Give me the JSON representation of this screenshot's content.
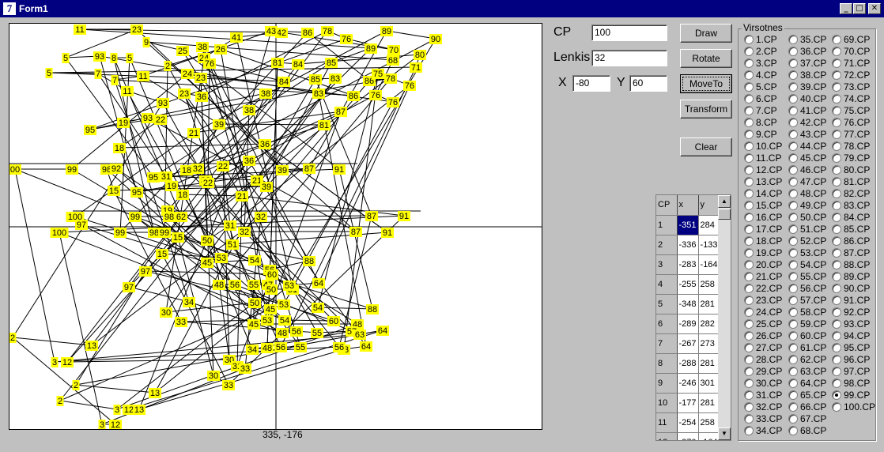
{
  "window": {
    "title": "Form1",
    "icon": "delphi-icon"
  },
  "caption_buttons": [
    {
      "name": "minimize-button",
      "glyph": "_"
    },
    {
      "name": "maximize-button",
      "glyph": "□"
    },
    {
      "name": "close-button",
      "glyph": "✕"
    }
  ],
  "controls": {
    "cp_label": "CP",
    "cp_value": "100",
    "lenkis_label": "Lenkis",
    "lenkis_value": "32",
    "x_label": "X",
    "x_value": "-80",
    "y_label": "Y",
    "y_value": "60"
  },
  "buttons": [
    {
      "id": "draw",
      "label": "Draw"
    },
    {
      "id": "rotate",
      "label": "Rotate"
    },
    {
      "id": "moveto",
      "label": "MoveTo"
    },
    {
      "id": "transform",
      "label": "Transform"
    },
    {
      "id": "clear",
      "label": "Clear"
    }
  ],
  "status": {
    "coordinates": "335, -176"
  },
  "grid": {
    "headers": [
      "CP",
      "x",
      "y"
    ],
    "rows": [
      [
        "1",
        "-351",
        "284"
      ],
      [
        "2",
        "-336",
        "-133"
      ],
      [
        "3",
        "-283",
        "-164"
      ],
      [
        "4",
        "-255",
        "258"
      ],
      [
        "5",
        "-348",
        "281"
      ],
      [
        "6",
        "-289",
        "282"
      ],
      [
        "7",
        "-267",
        "273"
      ],
      [
        "8",
        "-288",
        "281"
      ],
      [
        "9",
        "-246",
        "301"
      ],
      [
        "10",
        "-177",
        "281"
      ],
      [
        "11",
        "-254",
        "258"
      ],
      [
        "12",
        "-270",
        "-164"
      ]
    ]
  },
  "radio_group": {
    "caption": "Virsotnes",
    "selected": "99.CP"
  },
  "canvas": {
    "background": "#ffffff",
    "label_color": "#ffff00",
    "label_text_color": "#000000",
    "line_color": "#000000",
    "labels": [
      [
        "11",
        100,
        36
      ],
      [
        "23",
        172,
        36
      ],
      [
        "41",
        298,
        46
      ],
      [
        "42",
        355,
        40
      ],
      [
        "43",
        342,
        38
      ],
      [
        "86",
        388,
        40
      ],
      [
        "78",
        413,
        38
      ],
      [
        "76",
        437,
        48
      ],
      [
        "89",
        488,
        38
      ],
      [
        "90",
        550,
        48
      ],
      [
        "5",
        82,
        72
      ],
      [
        "93",
        125,
        70
      ],
      [
        "8",
        143,
        72
      ],
      [
        "5",
        163,
        72
      ],
      [
        "9",
        184,
        52
      ],
      [
        "25",
        230,
        63
      ],
      [
        "38",
        255,
        58
      ],
      [
        "24",
        257,
        72
      ],
      [
        "26",
        278,
        61
      ],
      [
        "2",
        211,
        82
      ],
      [
        "81",
        350,
        78
      ],
      [
        "84",
        376,
        80
      ],
      [
        "85",
        418,
        78
      ],
      [
        "89",
        468,
        60
      ],
      [
        "70",
        497,
        62
      ],
      [
        "68",
        496,
        75
      ],
      [
        "80",
        530,
        68
      ],
      [
        "71",
        525,
        84
      ],
      [
        "5",
        61,
        91
      ],
      [
        "7",
        123,
        92
      ],
      [
        "7",
        144,
        100
      ],
      [
        "11",
        180,
        95
      ],
      [
        "24",
        236,
        92
      ],
      [
        "23",
        253,
        97
      ],
      [
        "76",
        264,
        79
      ],
      [
        "84",
        358,
        102
      ],
      [
        "85",
        398,
        99
      ],
      [
        "83",
        423,
        98
      ],
      [
        "86",
        466,
        101
      ],
      [
        "78",
        493,
        98
      ],
      [
        "76",
        517,
        107
      ],
      [
        "75",
        477,
        92
      ],
      [
        "11",
        160,
        114
      ],
      [
        "93",
        205,
        129
      ],
      [
        "23",
        232,
        117
      ],
      [
        "36",
        254,
        121
      ],
      [
        "38",
        335,
        117
      ],
      [
        "38",
        314,
        138
      ],
      [
        "83",
        402,
        117
      ],
      [
        "86",
        446,
        120
      ],
      [
        "76",
        474,
        119
      ],
      [
        "76",
        496,
        128
      ],
      [
        "95",
        113,
        163
      ],
      [
        "19",
        155,
        154
      ],
      [
        "93",
        186,
        148
      ],
      [
        "22",
        202,
        150
      ],
      [
        "39",
        276,
        156
      ],
      [
        "81",
        409,
        157
      ],
      [
        "87",
        430,
        140
      ],
      [
        "21",
        244,
        167
      ],
      [
        "18",
        150,
        186
      ],
      [
        "36",
        334,
        181
      ],
      [
        "00",
        18,
        213
      ],
      [
        "99",
        90,
        213
      ],
      [
        "98",
        134,
        213
      ],
      [
        "92",
        146,
        212
      ],
      [
        "18",
        235,
        214
      ],
      [
        "32",
        249,
        212
      ],
      [
        "22",
        281,
        209
      ],
      [
        "36",
        314,
        202
      ],
      [
        "39",
        356,
        214
      ],
      [
        "87",
        390,
        212
      ],
      [
        "91",
        428,
        213
      ],
      [
        "95",
        193,
        223
      ],
      [
        "31",
        209,
        222
      ],
      [
        "21",
        324,
        227
      ],
      [
        "32",
        259,
        227
      ],
      [
        "22",
        262,
        230
      ],
      [
        "39",
        336,
        235
      ],
      [
        "15",
        143,
        240
      ],
      [
        "95",
        172,
        242
      ],
      [
        "19",
        216,
        234
      ],
      [
        "18",
        230,
        245
      ],
      [
        "21",
        305,
        247
      ],
      [
        "19",
        211,
        265
      ],
      [
        "98",
        213,
        273
      ],
      [
        "99",
        170,
        273
      ],
      [
        "62",
        228,
        273
      ],
      [
        "100",
        94,
        273
      ],
      [
        "97",
        102,
        283
      ],
      [
        "32",
        329,
        273
      ],
      [
        "87",
        469,
        272
      ],
      [
        "91",
        510,
        272
      ],
      [
        "100",
        74,
        293
      ],
      [
        "99",
        151,
        293
      ],
      [
        "98",
        194,
        293
      ],
      [
        "99",
        207,
        293
      ],
      [
        "15",
        224,
        299
      ],
      [
        "50",
        261,
        303
      ],
      [
        "31",
        290,
        284
      ],
      [
        "32",
        308,
        292
      ],
      [
        "87",
        449,
        292
      ],
      [
        "91",
        489,
        293
      ],
      [
        "51",
        293,
        308
      ],
      [
        "15",
        204,
        320
      ],
      [
        "53",
        279,
        325
      ],
      [
        "45",
        261,
        331
      ],
      [
        "54",
        321,
        328
      ],
      [
        "88",
        390,
        329
      ],
      [
        "56",
        340,
        340
      ],
      [
        "60",
        343,
        346
      ],
      [
        "97",
        183,
        342
      ],
      [
        "48",
        276,
        359
      ],
      [
        "56",
        296,
        359
      ],
      [
        "55",
        320,
        359
      ],
      [
        "47",
        338,
        359
      ],
      [
        "50",
        342,
        365
      ],
      [
        "51",
        369,
        365
      ],
      [
        "53",
        365,
        360
      ],
      [
        "64",
        402,
        357
      ],
      [
        "97",
        162,
        362
      ],
      [
        "34",
        238,
        381
      ],
      [
        "30",
        209,
        394
      ],
      [
        "50",
        321,
        382
      ],
      [
        "53",
        358,
        384
      ],
      [
        "45",
        341,
        390
      ],
      [
        "54",
        401,
        388
      ],
      [
        "88",
        470,
        390
      ],
      [
        "33",
        228,
        406
      ],
      [
        "53",
        337,
        404
      ],
      [
        "54",
        359,
        404
      ],
      [
        "60",
        421,
        405
      ],
      [
        "48",
        451,
        409
      ],
      [
        "45",
        320,
        409
      ],
      [
        "48",
        356,
        420
      ],
      [
        "56",
        374,
        418
      ],
      [
        "55",
        400,
        420
      ],
      [
        "57",
        444,
        418
      ],
      [
        "63",
        454,
        422
      ],
      [
        "64",
        483,
        417
      ],
      [
        "2",
        15,
        426
      ],
      [
        "13",
        115,
        436
      ],
      [
        "34",
        318,
        441
      ],
      [
        "48",
        337,
        439
      ],
      [
        "56",
        354,
        438
      ],
      [
        "55",
        379,
        438
      ],
      [
        "63",
        434,
        441
      ],
      [
        "64",
        462,
        437
      ],
      [
        "56",
        428,
        438
      ],
      [
        "3",
        68,
        457
      ],
      [
        "12",
        84,
        457
      ],
      [
        "30",
        289,
        454
      ],
      [
        "31",
        299,
        462
      ],
      [
        "33",
        309,
        465
      ],
      [
        "30",
        269,
        474
      ],
      [
        "33",
        288,
        486
      ],
      [
        "2",
        95,
        486
      ],
      [
        "13",
        195,
        496
      ],
      [
        "2",
        75,
        506
      ],
      [
        "3",
        147,
        517
      ],
      [
        "12",
        162,
        517
      ],
      [
        "13",
        175,
        517
      ],
      [
        "3",
        128,
        536
      ],
      [
        "12",
        145,
        536
      ]
    ]
  }
}
